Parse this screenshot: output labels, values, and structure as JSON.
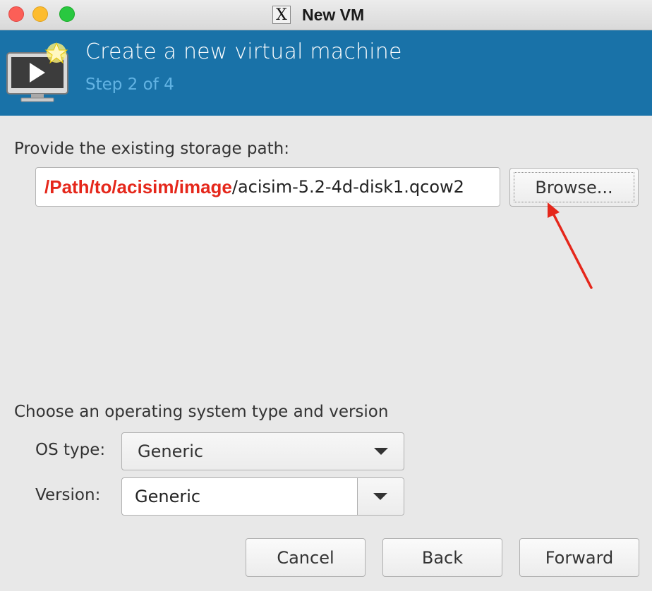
{
  "window": {
    "title": "New VM"
  },
  "banner": {
    "title": "Create a new virtual machine",
    "step": "Step 2 of 4",
    "background": "#1972a8",
    "step_color": "#62b3e3"
  },
  "storage": {
    "label": "Provide the existing storage path:",
    "path_highlight": "/Path/to/acisim/image",
    "path_rest": "/acisim-5.2-4d-disk1.qcow2",
    "browse_label": "Browse..."
  },
  "os": {
    "section_label": "Choose an operating system type and version",
    "type_label": "OS type:",
    "type_value": "Generic",
    "version_label": "Version:",
    "version_value": "Generic"
  },
  "buttons": {
    "cancel": "Cancel",
    "back": "Back",
    "forward": "Forward"
  },
  "annotation": {
    "arrow_color": "#e5271b"
  },
  "icons": [
    "x11-icon",
    "vm-monitor-icon",
    "new-star-icon",
    "dropdown-caret-icon"
  ]
}
